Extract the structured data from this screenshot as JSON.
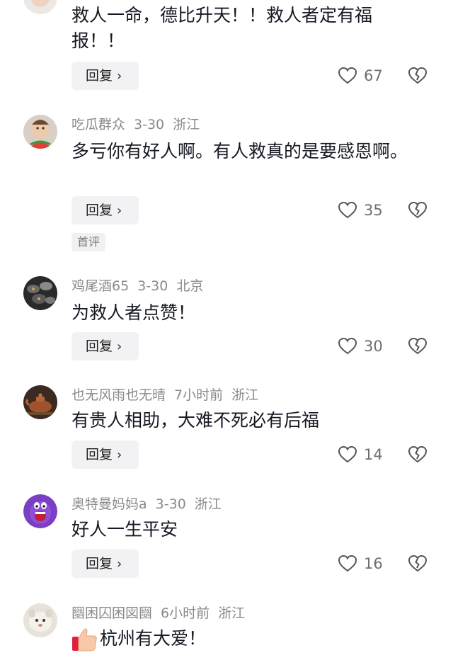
{
  "comments": [
    {
      "username": "",
      "date": "",
      "location": "",
      "text": "救人一命，德比升天！！救人者定有福报！！",
      "reply_label": "回复",
      "likes": "67"
    },
    {
      "username": "吃瓜群众",
      "date": "3-30",
      "location": "浙江",
      "text": "多亏你有好人啊。有人救真的是要感恩啊。",
      "reply_label": "回复",
      "likes": "35",
      "badge": "首评"
    },
    {
      "username": "鸡尾酒65",
      "date": "3-30",
      "location": "北京",
      "text": "为救人者点赞！",
      "reply_label": "回复",
      "likes": "30"
    },
    {
      "username": "也无风雨也无晴",
      "date": "7小时前",
      "location": "浙江",
      "text": "有贵人相助，大难不死必有后福",
      "reply_label": "回复",
      "likes": "14"
    },
    {
      "username": "奥特曼妈妈a",
      "date": "3-30",
      "location": "浙江",
      "text": "好人一生平安",
      "reply_label": "回复",
      "likes": "16"
    },
    {
      "username": "圝困囚困図圝",
      "date": "6小时前",
      "location": "浙江",
      "text": "杭州有大爱！",
      "thumb_emoji": "thumbs-up-emoji"
    }
  ],
  "icons": {
    "like": "heart-outline-icon",
    "dislike": "broken-heart-icon",
    "reply_chevron": "chevron-right-icon"
  },
  "colors": {
    "text": "#161823",
    "meta": "#8a8a8a",
    "reply_bg": "#f2f2f4"
  }
}
